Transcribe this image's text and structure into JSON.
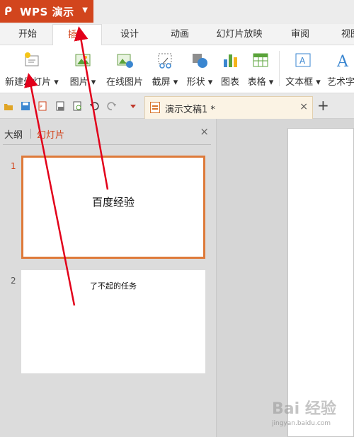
{
  "app": {
    "name": "WPS 演示",
    "logo_glyph": "ᑭ",
    "accent": "#d2451d"
  },
  "menu_tabs": [
    "开始",
    "插入",
    "设计",
    "动画",
    "幻灯片放映",
    "审阅",
    "视图"
  ],
  "active_tab": "插入",
  "ribbon": {
    "new_slide": "新建幻灯片",
    "picture": "图片",
    "online_picture": "在线图片",
    "screenshot": "截屏",
    "shape": "形状",
    "chart": "图表",
    "table": "表格",
    "textbox": "文本框",
    "wordart": "艺术字"
  },
  "document": {
    "tab_title": "演示文稿1 *",
    "close_glyph": "×",
    "new_tab_glyph": "+"
  },
  "panel": {
    "outline_tab": "大纲",
    "slides_tab": "幻灯片",
    "close_glyph": "×",
    "slides": [
      {
        "number": "1",
        "text": "百度经验",
        "selected": true
      },
      {
        "number": "2",
        "text": "了不起的任务",
        "selected": false
      }
    ]
  },
  "watermark": {
    "main": "Bai 经验",
    "sub": "jingyan.baidu.com"
  },
  "colors": {
    "arrow": "#e2001a",
    "selection": "#de7a3a"
  }
}
